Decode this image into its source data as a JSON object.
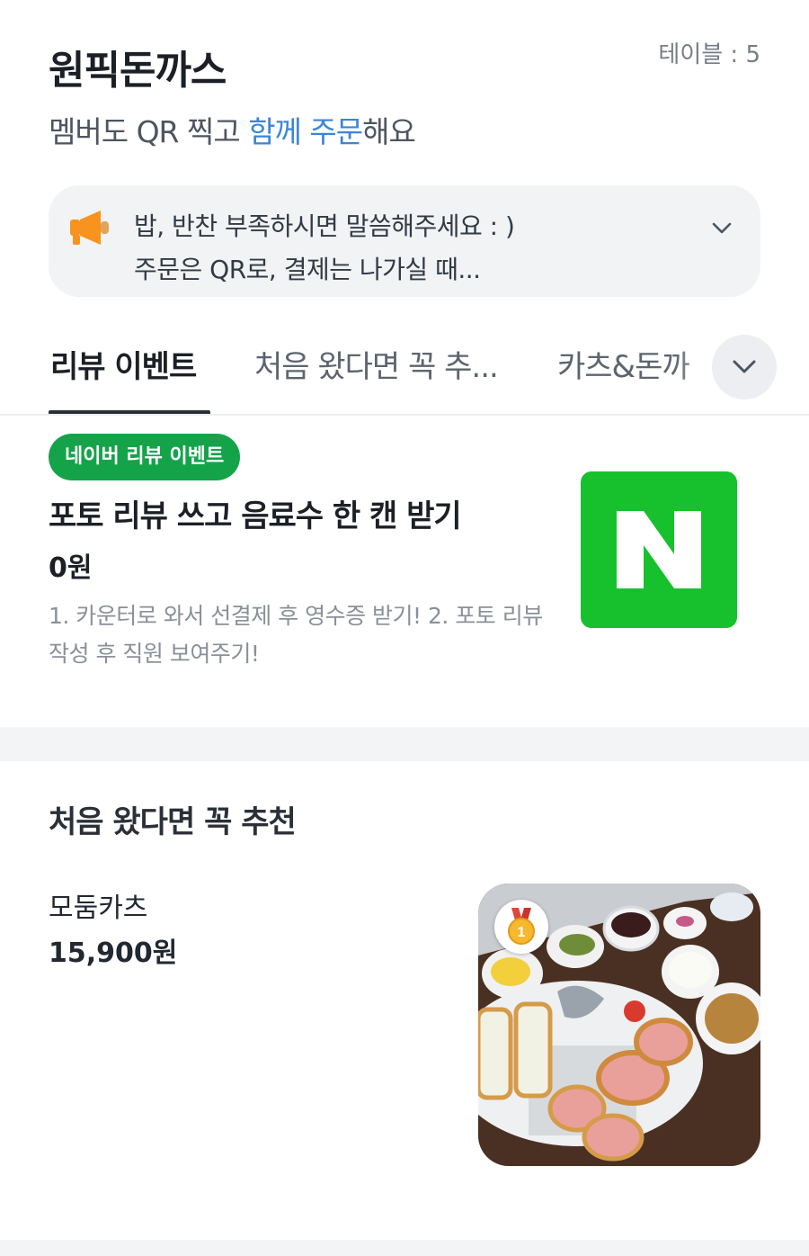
{
  "header": {
    "restaurant_name": "원픽돈까스",
    "table_label": "테이블 : 5",
    "subtitle_prefix": "멤버도 QR 찍고 ",
    "subtitle_highlight": "함께 주문",
    "subtitle_suffix": "해요"
  },
  "notice": {
    "icon": "megaphone-icon",
    "line1": "밥, 반찬 부족하시면 말씀해주세요 : )",
    "line2": "주문은 QR로, 결제는 나가실 때...",
    "expand_icon": "chevron-down-icon"
  },
  "tabs": [
    {
      "label": "리뷰 이벤트",
      "active": true
    },
    {
      "label": "처음 왔다면 꼭 추...",
      "active": false
    },
    {
      "label": "카츠&돈까",
      "active": false
    }
  ],
  "event": {
    "badge": "네이버 리뷰 이벤트",
    "title": "포토 리뷰 쓰고 음료수 한 캔 받기",
    "price": "0원",
    "description": "1. 카운터로 와서 선결제 후 영수증 받기! 2. 포토 리뷰 작성 후 직원 보여주기!",
    "logo_letter": "N"
  },
  "section": {
    "title": "처음 왔다면 꼭 추천",
    "items": [
      {
        "name": "모둠카츠",
        "price": "15,900원",
        "rank": "1"
      }
    ]
  },
  "colors": {
    "accent_blue": "#3a86d9",
    "naver_green": "#17c12d",
    "badge_green": "#15a34a",
    "megaphone_orange": "#f7931e"
  }
}
